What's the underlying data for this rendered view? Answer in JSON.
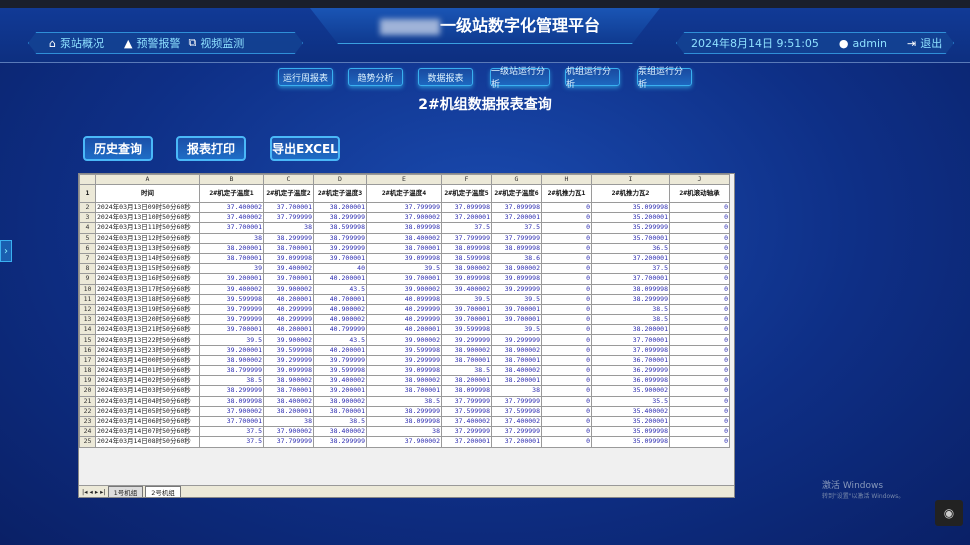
{
  "header": {
    "title_suffix": "一级站数字化管理平台",
    "datetime": "2024年8月14日 9:51:05",
    "user": "admin",
    "logout": "退出",
    "nav": [
      {
        "label": "泵站概况",
        "icon": "home-icon"
      },
      {
        "label": "预警报警",
        "icon": "alarm-icon"
      },
      {
        "label": "视频监测",
        "icon": "video-icon"
      }
    ]
  },
  "tabs": [
    "运行周报表",
    "趋势分析",
    "数据报表",
    "一级站运行分析",
    "机组运行分析",
    "泵组运行分析"
  ],
  "page_title": "2#机组数据报表查询",
  "buttons": {
    "history": "历史查询",
    "print": "报表打印",
    "export": "导出EXCEL"
  },
  "sheet": {
    "column_letters": [
      "A",
      "B",
      "C",
      "D",
      "E",
      "F",
      "G",
      "H",
      "I",
      "J"
    ],
    "headers": [
      "时间",
      "2#机定子温度1",
      "2#机定子温度2",
      "2#机定子温度3",
      "2#机定子温度4",
      "2#机定子温度5",
      "2#机定子温度6",
      "2#机推力瓦1",
      "2#机推力瓦2",
      "2#机滚动轴承"
    ],
    "rows": [
      [
        "2024年03月13日09时50分60秒",
        "37.400002",
        "37.700001",
        "38.200001",
        "37.799999",
        "37.099998",
        "37.099998",
        "0",
        "35.099998",
        "0"
      ],
      [
        "2024年03月13日10时50分60秒",
        "37.400002",
        "37.799999",
        "38.299999",
        "37.900002",
        "37.200001",
        "37.200001",
        "0",
        "35.200001",
        "0"
      ],
      [
        "2024年03月13日11时50分60秒",
        "37.700001",
        "38",
        "38.599998",
        "38.099998",
        "37.5",
        "37.5",
        "0",
        "35.299999",
        "0"
      ],
      [
        "2024年03月13日12时50分60秒",
        "38",
        "38.299999",
        "38.799999",
        "38.400002",
        "37.799999",
        "37.799999",
        "0",
        "35.700001",
        "0"
      ],
      [
        "2024年03月13日13时50分60秒",
        "38.200001",
        "38.700001",
        "39.299999",
        "38.700001",
        "38.099998",
        "38.099998",
        "0",
        "36.5",
        "0"
      ],
      [
        "2024年03月13日14时50分60秒",
        "38.700001",
        "39.099998",
        "39.700001",
        "39.099998",
        "38.599998",
        "38.6",
        "0",
        "37.200001",
        "0"
      ],
      [
        "2024年03月13日15时50分60秒",
        "39",
        "39.400002",
        "40",
        "39.5",
        "38.900002",
        "38.900002",
        "0",
        "37.5",
        "0"
      ],
      [
        "2024年03月13日16时50分60秒",
        "39.200001",
        "39.700001",
        "40.200001",
        "39.700001",
        "39.099998",
        "39.099998",
        "0",
        "37.700001",
        "0"
      ],
      [
        "2024年03月13日17时50分60秒",
        "39.400002",
        "39.900002",
        "43.5",
        "39.900002",
        "39.400002",
        "39.299999",
        "0",
        "38.099998",
        "0"
      ],
      [
        "2024年03月13日18时50分60秒",
        "39.599998",
        "40.200001",
        "40.700001",
        "40.099998",
        "39.5",
        "39.5",
        "0",
        "38.299999",
        "0"
      ],
      [
        "2024年03月13日19时50分60秒",
        "39.799999",
        "40.299999",
        "40.900002",
        "40.299999",
        "39.700001",
        "39.700001",
        "0",
        "38.5",
        "0"
      ],
      [
        "2024年03月13日20时50分60秒",
        "39.799999",
        "40.299999",
        "40.900002",
        "40.299999",
        "39.700001",
        "39.700001",
        "0",
        "38.5",
        "0"
      ],
      [
        "2024年03月13日21时50分60秒",
        "39.700001",
        "40.200001",
        "40.799999",
        "40.200001",
        "39.599998",
        "39.5",
        "0",
        "38.200001",
        "0"
      ],
      [
        "2024年03月13日22时50分60秒",
        "39.5",
        "39.900002",
        "43.5",
        "39.900002",
        "39.299999",
        "39.299999",
        "0",
        "37.700001",
        "0"
      ],
      [
        "2024年03月13日23时50分60秒",
        "39.200001",
        "39.599998",
        "40.200001",
        "39.599998",
        "38.900002",
        "38.900002",
        "0",
        "37.099998",
        "0"
      ],
      [
        "2024年03月14日00时50分60秒",
        "38.900002",
        "39.299999",
        "39.799999",
        "39.299999",
        "38.700001",
        "38.700001",
        "0",
        "36.700001",
        "0"
      ],
      [
        "2024年03月14日01时50分60秒",
        "38.799999",
        "39.099998",
        "39.599998",
        "39.099998",
        "38.5",
        "38.400002",
        "0",
        "36.299999",
        "0"
      ],
      [
        "2024年03月14日02时50分60秒",
        "38.5",
        "38.900002",
        "39.400002",
        "38.900002",
        "38.200001",
        "38.200001",
        "0",
        "36.099998",
        "0"
      ],
      [
        "2024年03月14日03时50分60秒",
        "38.299999",
        "38.700001",
        "39.200001",
        "38.700001",
        "38.099998",
        "38",
        "0",
        "35.900002",
        "0"
      ],
      [
        "2024年03月14日04时50分60秒",
        "38.099998",
        "38.400002",
        "38.900002",
        "38.5",
        "37.799999",
        "37.799999",
        "0",
        "35.5",
        "0"
      ],
      [
        "2024年03月14日05时50分60秒",
        "37.900002",
        "38.200001",
        "38.700001",
        "38.299999",
        "37.599998",
        "37.599998",
        "0",
        "35.400002",
        "0"
      ],
      [
        "2024年03月14日06时50分60秒",
        "37.700001",
        "38",
        "38.5",
        "38.099998",
        "37.400002",
        "37.400002",
        "0",
        "35.200001",
        "0"
      ],
      [
        "2024年03月14日07时50分60秒",
        "37.5",
        "37.900002",
        "38.400002",
        "38",
        "37.299999",
        "37.299999",
        "0",
        "35.099998",
        "0"
      ],
      [
        "2024年03月14日08时50分60秒",
        "37.5",
        "37.799999",
        "38.299999",
        "37.900002",
        "37.200001",
        "37.200001",
        "0",
        "35.099998",
        "0"
      ]
    ],
    "sheet_tabs": [
      "1号机组",
      "2号机组"
    ],
    "active_sheet": "2号机组"
  },
  "watermark": {
    "line1": "激活 Windows",
    "line2": "转到\"设置\"以激活 Windows。"
  },
  "colors": {
    "accent": "#3ab0f0",
    "background": "#0e2f86",
    "cell_number": "#2a2ab0"
  }
}
